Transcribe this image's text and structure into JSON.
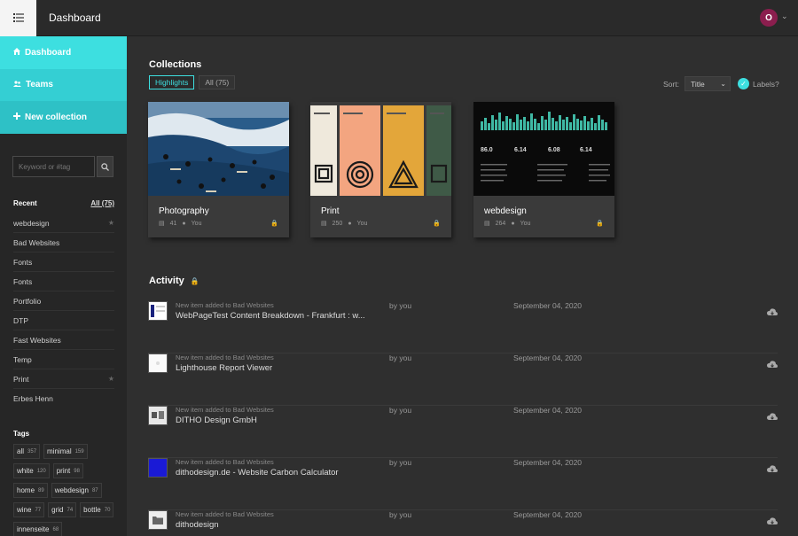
{
  "header": {
    "title": "Dashboard",
    "avatar_initial": "O"
  },
  "nav": [
    {
      "label": "Dashboard",
      "icon": "home-icon"
    },
    {
      "label": "Teams",
      "icon": "users-icon"
    },
    {
      "label": "New collection",
      "icon": "plus-icon"
    }
  ],
  "search": {
    "placeholder": "Keyword or #tag"
  },
  "recent": {
    "label": "Recent",
    "all_label": "All (75)",
    "items": [
      "webdesign",
      "Bad Websites",
      "Fonts",
      "Fonts",
      "Portfolio",
      "DTP",
      "Fast Websites",
      "Temp",
      "Print",
      "Erbes Henn"
    ]
  },
  "tags": {
    "label": "Tags",
    "items": [
      {
        "name": "all",
        "count": "357"
      },
      {
        "name": "minimal",
        "count": "159"
      },
      {
        "name": "white",
        "count": "120"
      },
      {
        "name": "print",
        "count": "98"
      },
      {
        "name": "home",
        "count": "89"
      },
      {
        "name": "webdesign",
        "count": "87"
      },
      {
        "name": "wine",
        "count": "77"
      },
      {
        "name": "grid",
        "count": "74"
      },
      {
        "name": "bottle",
        "count": "70"
      },
      {
        "name": "innenseite",
        "count": "68"
      }
    ]
  },
  "collections": {
    "title": "Collections",
    "filters": [
      "Highlights",
      "All (75)"
    ],
    "sort_label": "Sort:",
    "sort_value": "Title",
    "labels_toggle": "Labels?",
    "cards": [
      {
        "name": "Photography",
        "count": "41",
        "owner": "You"
      },
      {
        "name": "Print",
        "count": "250",
        "owner": "You"
      },
      {
        "name": "webdesign",
        "count": "264",
        "owner": "You"
      }
    ]
  },
  "activity": {
    "title": "Activity",
    "rows": [
      {
        "context": "New item added to Bad Websites",
        "name": "WebPageTest Content Breakdown - Frankfurt : w...",
        "by": "by you",
        "date": "September 04, 2020"
      },
      {
        "context": "New item added to Bad Websites",
        "name": "Lighthouse Report Viewer",
        "by": "by you",
        "date": "September 04, 2020"
      },
      {
        "context": "New item added to Bad Websites",
        "name": "DITHO Design GmbH",
        "by": "by you",
        "date": "September 04, 2020"
      },
      {
        "context": "New item added to Bad Websites",
        "name": "dithodesign.de - Website Carbon Calculator",
        "by": "by you",
        "date": "September 04, 2020"
      },
      {
        "context": "New item added to Bad Websites",
        "name": "dithodesign",
        "by": "by you",
        "date": "September 04, 2020"
      }
    ]
  }
}
